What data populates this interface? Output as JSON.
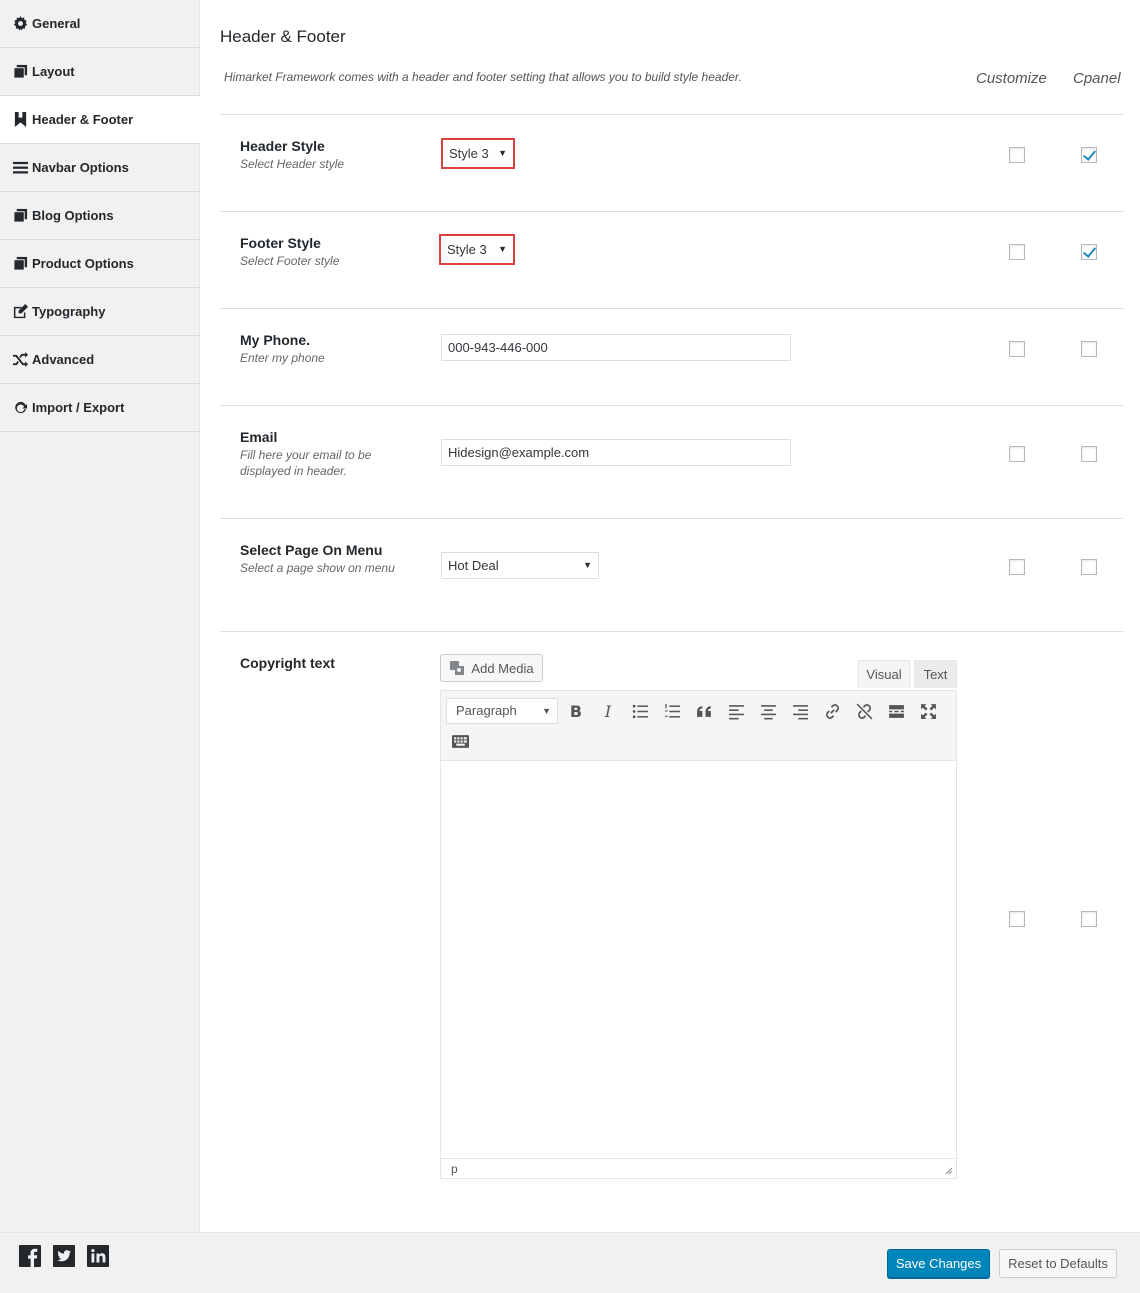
{
  "sidebar": {
    "items": [
      {
        "label": "General",
        "icon": "gear-icon"
      },
      {
        "label": "Layout",
        "icon": "copy-icon"
      },
      {
        "label": "Header & Footer",
        "icon": "bookmark-icon"
      },
      {
        "label": "Navbar Options",
        "icon": "bars-icon"
      },
      {
        "label": "Blog Options",
        "icon": "copy-icon"
      },
      {
        "label": "Product Options",
        "icon": "copy-icon"
      },
      {
        "label": "Typography",
        "icon": "edit-icon"
      },
      {
        "label": "Advanced",
        "icon": "random-icon"
      },
      {
        "label": "Import / Export",
        "icon": "refresh-icon"
      }
    ],
    "active": "Header & Footer"
  },
  "main": {
    "title": "Header & Footer",
    "intro": "Himarket Framework comes with a header and footer setting that allows you to build style header.",
    "col_customize": "Customize",
    "col_cpanel": "Cpanel",
    "rows": {
      "header_style": {
        "title": "Header Style",
        "desc": "Select Header style",
        "value": "Style 3",
        "customize": false,
        "cpanel": true
      },
      "footer_style": {
        "title": "Footer Style",
        "desc": "Select Footer style",
        "value": "Style 3",
        "customize": false,
        "cpanel": true
      },
      "phone": {
        "title": "My Phone.",
        "desc": "Enter my phone",
        "value": "000-943-446-000",
        "customize": false,
        "cpanel": false
      },
      "email": {
        "title": "Email",
        "desc": "Fill here your email to be displayed in header.",
        "value": "Hidesign@example.com",
        "customize": false,
        "cpanel": false
      },
      "page_menu": {
        "title": "Select Page On Menu",
        "desc": "Select a page show on menu",
        "value": "Hot Deal",
        "customize": false,
        "cpanel": false
      },
      "copyright": {
        "title": "Copyright text",
        "customize": false,
        "cpanel": false
      }
    },
    "editor": {
      "add_media": "Add Media",
      "tab_visual": "Visual",
      "tab_text": "Text",
      "format": "Paragraph",
      "status_path": "p",
      "buttons": [
        "bold-icon",
        "italic-icon",
        "bullet-list-icon",
        "numbered-list-icon",
        "blockquote-icon",
        "align-left-icon",
        "align-center-icon",
        "align-right-icon",
        "link-icon",
        "unlink-icon",
        "read-more-icon",
        "fullscreen-icon",
        "toolbar-toggle-icon"
      ]
    }
  },
  "footer": {
    "save": "Save Changes",
    "reset": "Reset to Defaults",
    "social": [
      "facebook-icon",
      "twitter-icon",
      "linkedin-icon"
    ]
  },
  "colors": {
    "primary_button": "#0085ba",
    "highlight_border": "#d94040",
    "checkmark": "#1e8cbe"
  }
}
